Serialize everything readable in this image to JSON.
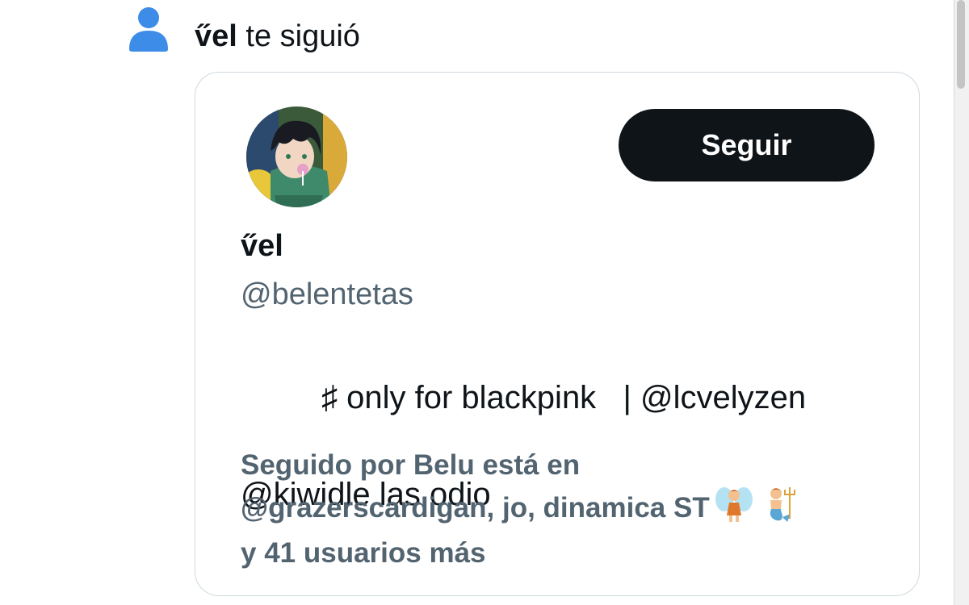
{
  "notification": {
    "name": "v̋el",
    "action": " te siguió",
    "icon": "person-icon",
    "icon_color": "#3d8ce8"
  },
  "card": {
    "display_name": "v̋el",
    "handle": "@belentetas",
    "follow_label": "Seguir",
    "bio_line1": "   ♯ only for blackpink",
    "bio_line1_tail": "   | @lcvelyzen",
    "bio_line2": "@kiwidle las odio",
    "followed_by_line1": "Seguido por Belu está en",
    "followed_by_line2": "@grazerscardigan, jo, dinamica ST",
    "followed_by_emojis": [
      "fairy-emoji",
      "merman-emoji"
    ],
    "followed_by_line3": "y 41 usuarios más"
  },
  "colors": {
    "button_bg": "#0f1419",
    "secondary_text": "#536471",
    "border": "#cfd9de"
  }
}
